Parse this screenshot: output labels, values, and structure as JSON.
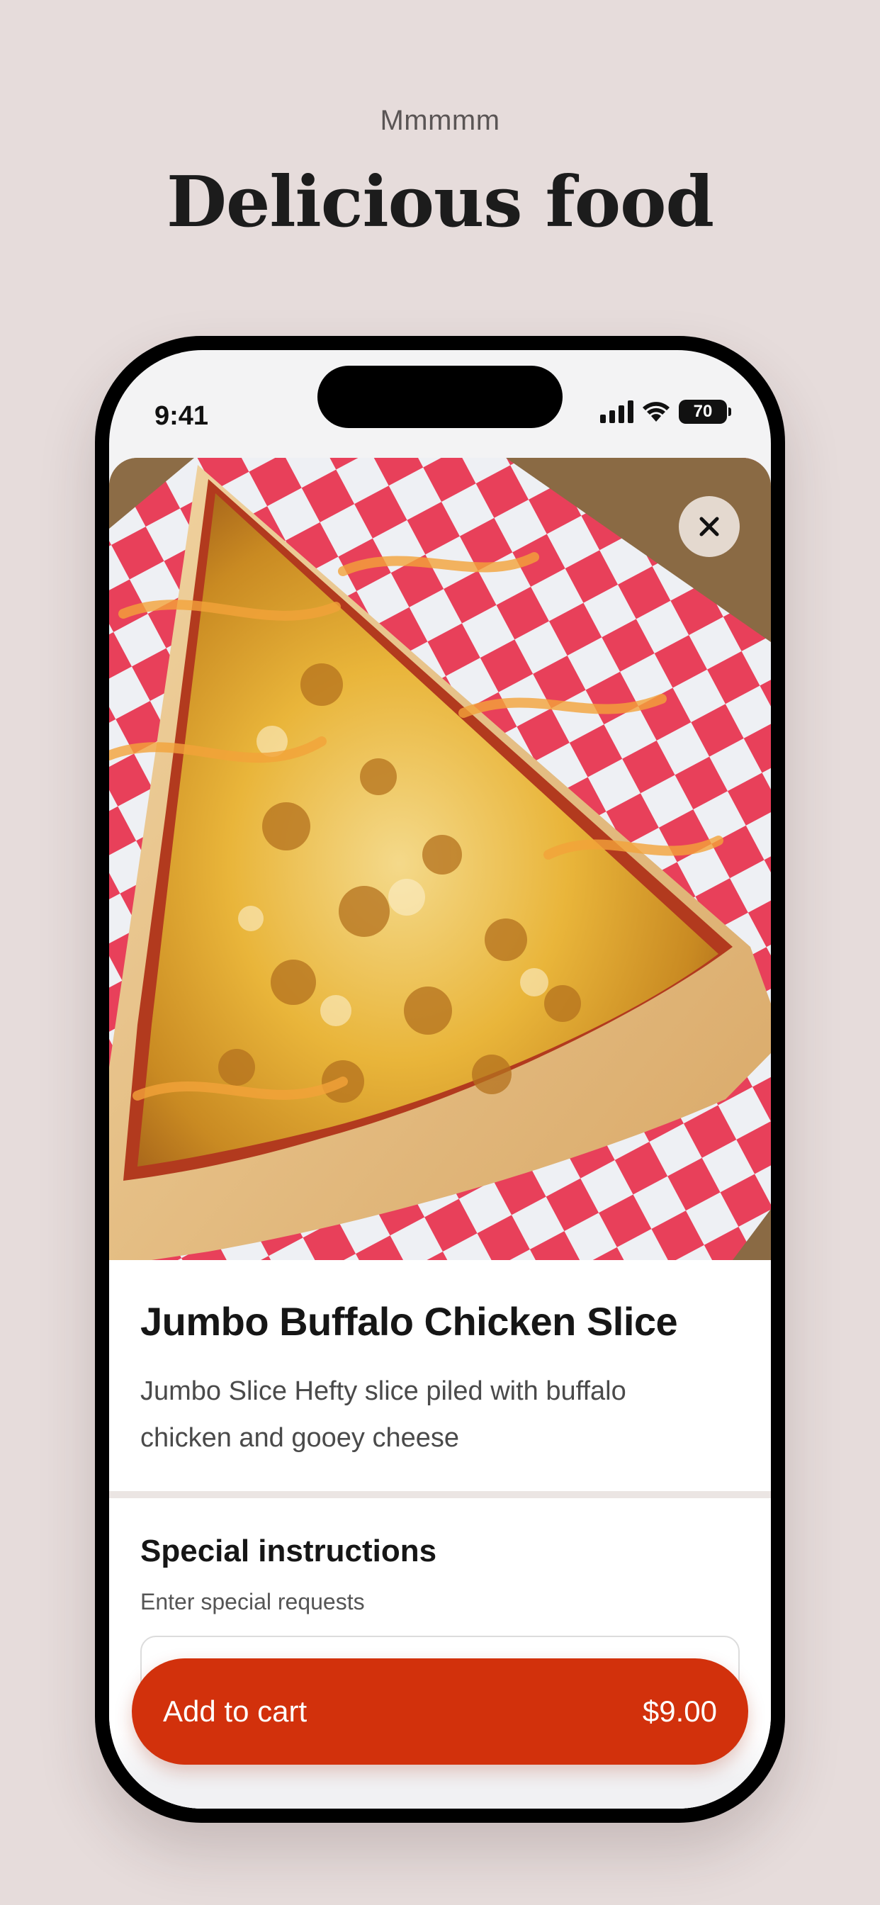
{
  "promo": {
    "kicker": "Mmmmm",
    "headline": "Delicious food"
  },
  "status_bar": {
    "time": "9:41",
    "battery": "70",
    "icons": [
      "cellular-signal-icon",
      "wifi-icon",
      "battery-icon"
    ]
  },
  "item": {
    "image_icon": "pizza-slice-photo",
    "title": "Jumbo Buffalo Chicken Slice",
    "description": "Jumbo Slice Hefty slice piled with buffalo chicken and gooey cheese"
  },
  "instructions": {
    "title": "Special instructions",
    "subtitle": "Enter special requests",
    "value": ""
  },
  "cart": {
    "label": "Add to cart",
    "price": "$9.00"
  },
  "colors": {
    "background": "#e6dcdb",
    "accent": "#d2310c"
  }
}
